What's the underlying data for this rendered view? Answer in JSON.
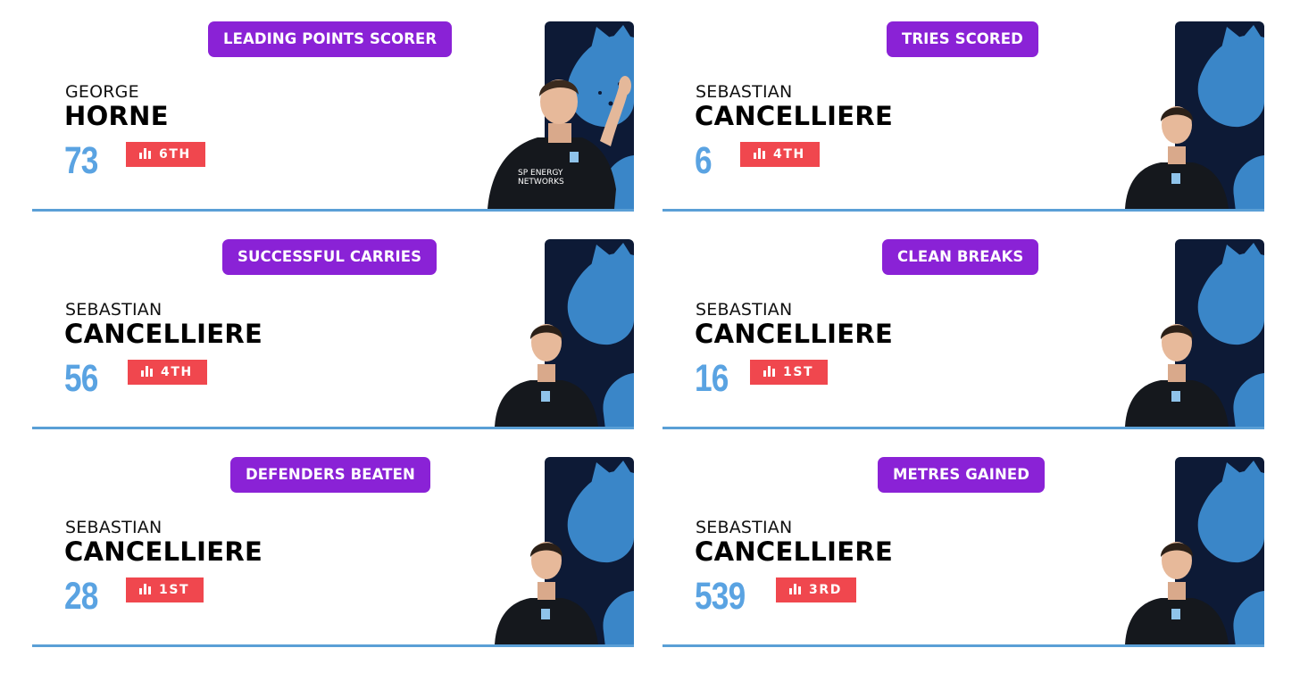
{
  "cards": [
    {
      "category": "LEADING POINTS SCORER",
      "first_name": "GEORGE",
      "last_name": "HORNE",
      "value": "73",
      "rank": "6TH"
    },
    {
      "category": "TRIES SCORED",
      "first_name": "SEBASTIAN",
      "last_name": "CANCELLIERE",
      "value": "6",
      "rank": "4TH"
    },
    {
      "category": "SUCCESSFUL CARRIES",
      "first_name": "SEBASTIAN",
      "last_name": "CANCELLIERE",
      "value": "56",
      "rank": "4TH"
    },
    {
      "category": "CLEAN BREAKS",
      "first_name": "SEBASTIAN",
      "last_name": "CANCELLIERE",
      "value": "16",
      "rank": "1ST"
    },
    {
      "category": "DEFENDERS BEATEN",
      "first_name": "SEBASTIAN",
      "last_name": "CANCELLIERE",
      "value": "28",
      "rank": "1ST"
    },
    {
      "category": "METRES GAINED",
      "first_name": "SEBASTIAN",
      "last_name": "CANCELLIERE",
      "value": "539",
      "rank": "3RD"
    }
  ],
  "sponsor_text": [
    "SP ENERGY",
    "NETWORKS"
  ],
  "icons": {
    "rank": "bar-chart-icon"
  },
  "colors": {
    "badge": "#8a22d6",
    "rank": "#f0474e",
    "value": "#5aa3e2",
    "panel_dark": "#0d1a36",
    "panel_light": "#3a86c8",
    "underline": "#5a9fd6"
  }
}
